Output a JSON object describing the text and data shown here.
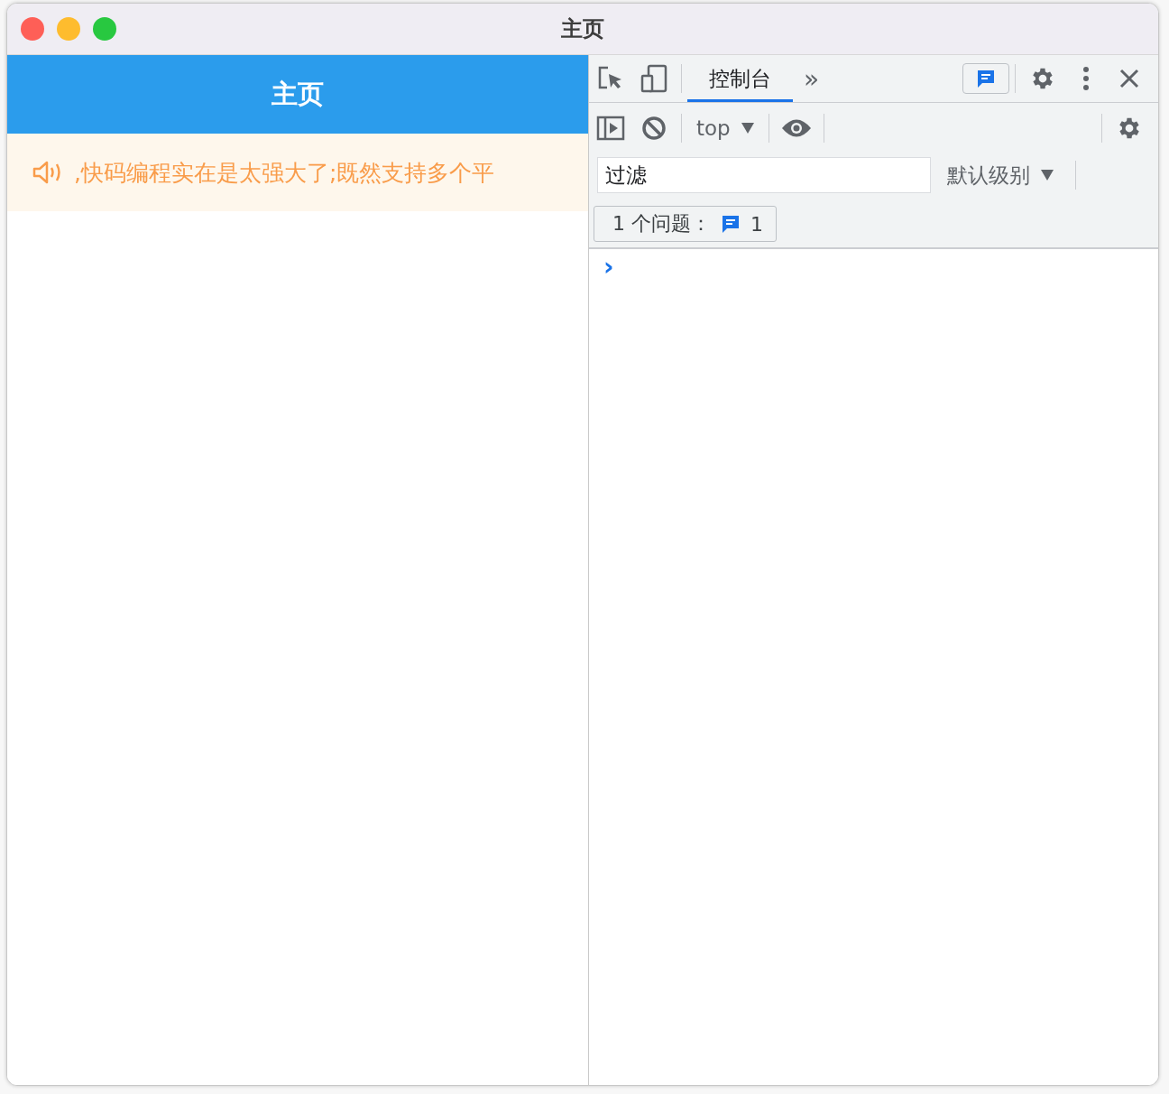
{
  "window": {
    "title": "主页"
  },
  "app": {
    "header": {
      "title": "主页"
    },
    "notice": {
      "text": ",快码编程实在是太强大了;既然支持多个平"
    }
  },
  "devtools": {
    "tabs": [
      {
        "label": "控制台",
        "selected": true
      }
    ],
    "more_tabs": "»",
    "context": "top",
    "filter": {
      "placeholder": "过滤"
    },
    "level_select": "默认级别",
    "issues": {
      "label": "1 个问题：",
      "count": "1"
    },
    "prompt": "›"
  }
}
